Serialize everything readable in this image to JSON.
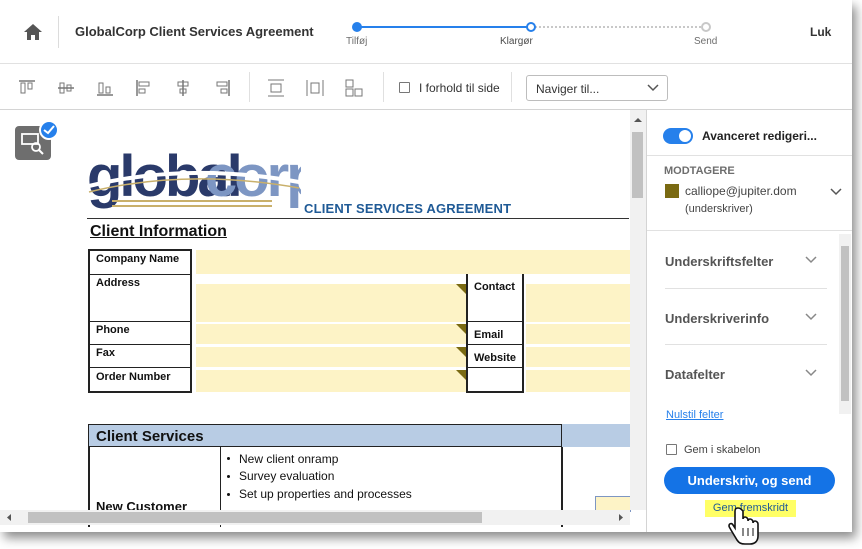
{
  "header": {
    "title": "GlobalCorp Client Services Agreement",
    "steps": [
      "Tilføj",
      "Klargør",
      "Send"
    ],
    "close_label": "Luk"
  },
  "toolbar": {
    "proportion_label": "I forhold til side",
    "navigate_placeholder": "Naviger til..."
  },
  "document": {
    "logo_text": "globalcorp",
    "agreement_title": "CLIENT SERVICES AGREEMENT",
    "section_heading": "Client Information",
    "fields": {
      "company_name": "Company Name",
      "address": "Address",
      "contact": "Contact",
      "phone": "Phone",
      "email": "Email",
      "fax": "Fax",
      "website": "Website",
      "order_number": "Order Number"
    },
    "services_heading": "Client Services",
    "new_customer_label": "New Customer",
    "services_items": [
      "New client onramp",
      "Survey evaluation",
      "Set up properties and processes"
    ]
  },
  "panel": {
    "advanced_label": "Avanceret redigeri...",
    "recipients_heading": "MODTAGERE",
    "recipient_email": "calliope@jupiter.dom",
    "recipient_role": "(underskriver)",
    "recipient_color": "#7a6a12",
    "sections": [
      "Underskriftsfelter",
      "Underskriverinfo",
      "Datafelter"
    ],
    "reset_link": "Nulstil felter",
    "save_template_label": "Gem i skabelon",
    "primary_button": "Underskriv, og send",
    "save_progress": "Gem fremskridt"
  },
  "colors": {
    "accent": "#2680eb",
    "field_highlight": "#fdf3c6",
    "services_header": "#b8cce4"
  }
}
